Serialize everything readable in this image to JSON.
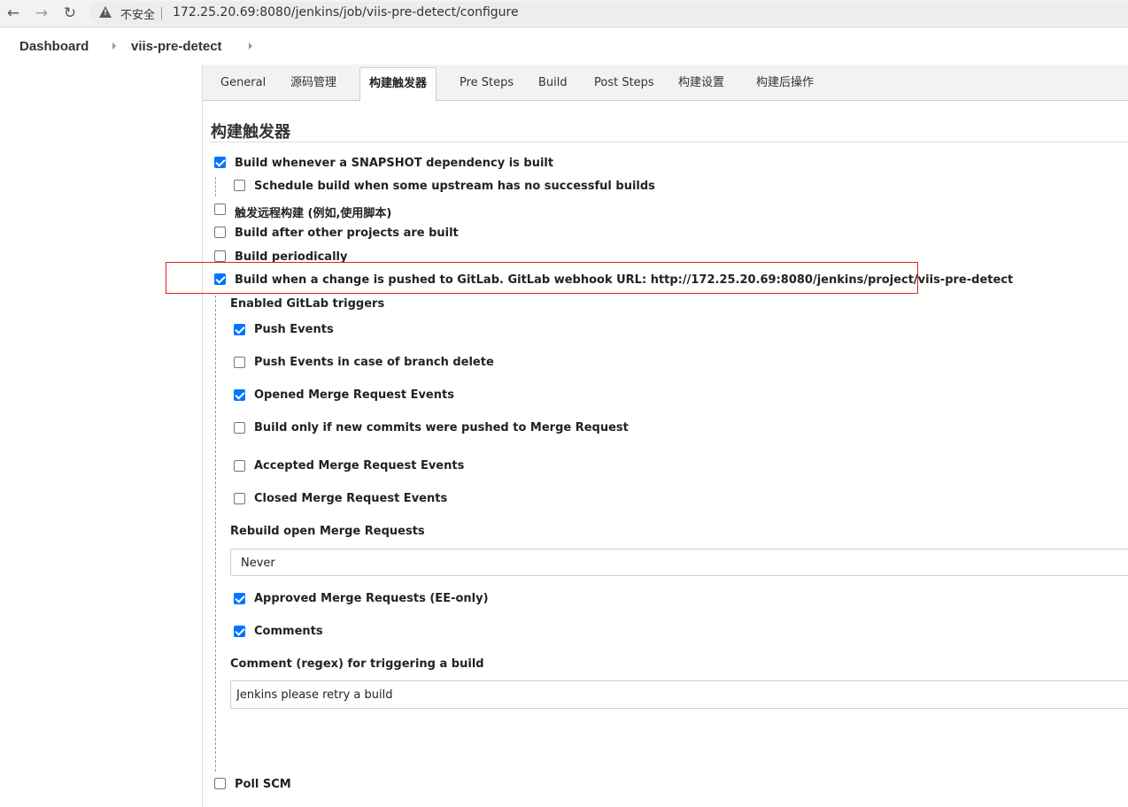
{
  "browser": {
    "insecure_label": "不安全",
    "url": "172.25.20.69:8080/jenkins/job/viis-pre-detect/configure"
  },
  "breadcrumb": {
    "dashboard": "Dashboard",
    "project": "viis-pre-detect"
  },
  "tabs": [
    {
      "label": "General"
    },
    {
      "label": "源码管理"
    },
    {
      "label": "构建触发器"
    },
    {
      "label": "Pre Steps"
    },
    {
      "label": "Build"
    },
    {
      "label": "Post Steps"
    },
    {
      "label": "构建设置"
    },
    {
      "label": "构建后操作"
    }
  ],
  "section": {
    "title": "构建触发器"
  },
  "triggers": {
    "snapshot": {
      "label": "Build whenever a SNAPSHOT dependency is built",
      "checked": true
    },
    "schedule_upstream": {
      "label": "Schedule build when some upstream has no successful builds",
      "checked": false
    },
    "remote": {
      "label": "触发远程构建 (例如,使用脚本)",
      "checked": false
    },
    "after_other": {
      "label": "Build after other projects are built",
      "checked": false
    },
    "periodically": {
      "label": "Build periodically",
      "checked": false
    },
    "gitlab_push": {
      "label": "Build when a change is pushed to GitLab. GitLab webhook URL: http://172.25.20.69:8080/jenkins/project/viis-pre-detect",
      "checked": true
    },
    "poll_scm": {
      "label": "Poll SCM",
      "checked": false
    }
  },
  "gitlab": {
    "enabled_triggers_label": "Enabled GitLab triggers",
    "push_events": {
      "label": "Push Events",
      "checked": true
    },
    "push_branch_delete": {
      "label": "Push Events in case of branch delete",
      "checked": false
    },
    "opened_mr": {
      "label": "Opened Merge Request Events",
      "checked": true
    },
    "new_commits_mr": {
      "label": "Build only if new commits were pushed to Merge Request",
      "checked": false
    },
    "accepted_mr": {
      "label": "Accepted Merge Request Events",
      "checked": false
    },
    "closed_mr": {
      "label": "Closed Merge Request Events",
      "checked": false
    },
    "rebuild_label": "Rebuild open Merge Requests",
    "rebuild_value": "Never",
    "approved_mr": {
      "label": "Approved Merge Requests (EE-only)",
      "checked": true
    },
    "comments": {
      "label": "Comments",
      "checked": true
    },
    "comment_regex_label": "Comment (regex) for triggering a build",
    "comment_regex_value": "Jenkins please retry a build"
  },
  "colors": {
    "checkbox_checked": "#0075ff",
    "highlight": "#e02020"
  }
}
